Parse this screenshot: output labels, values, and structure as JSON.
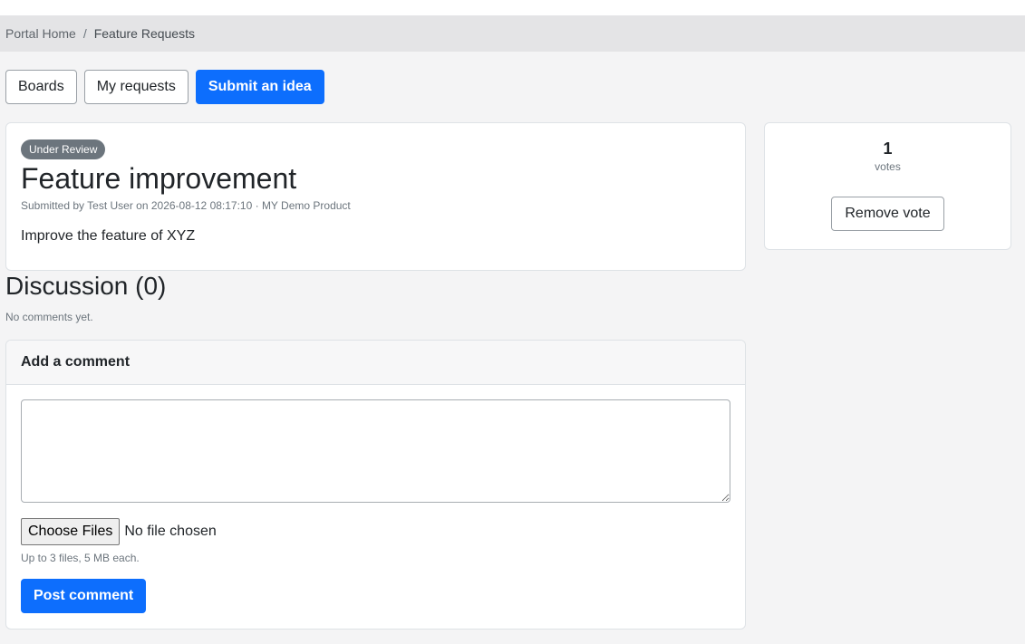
{
  "breadcrumb": {
    "home": "Portal Home",
    "separator": "/",
    "current": "Feature Requests"
  },
  "nav": {
    "boards": "Boards",
    "my_requests": "My requests",
    "submit_idea": "Submit an idea"
  },
  "idea": {
    "status": "Under Review",
    "title": "Feature improvement",
    "meta": "Submitted by Test User on 2026-08-12 08:17:10 · MY Demo Product",
    "body": "Improve the feature of XYZ"
  },
  "votes": {
    "count": "1",
    "label": "votes",
    "remove_label": "Remove vote"
  },
  "discussion": {
    "title": "Discussion (0)",
    "empty": "No comments yet."
  },
  "comment_form": {
    "header": "Add a comment",
    "textarea_value": "",
    "choose_files": "Choose Files",
    "file_status": "No file chosen",
    "hint": "Up to 3 files, 5 MB each.",
    "post_label": "Post comment"
  },
  "colors": {
    "primary": "#0d6efd",
    "badge": "#6c757d",
    "breadcrumb_bg": "#e4e4e6",
    "page_bg": "#f4f4f5"
  }
}
